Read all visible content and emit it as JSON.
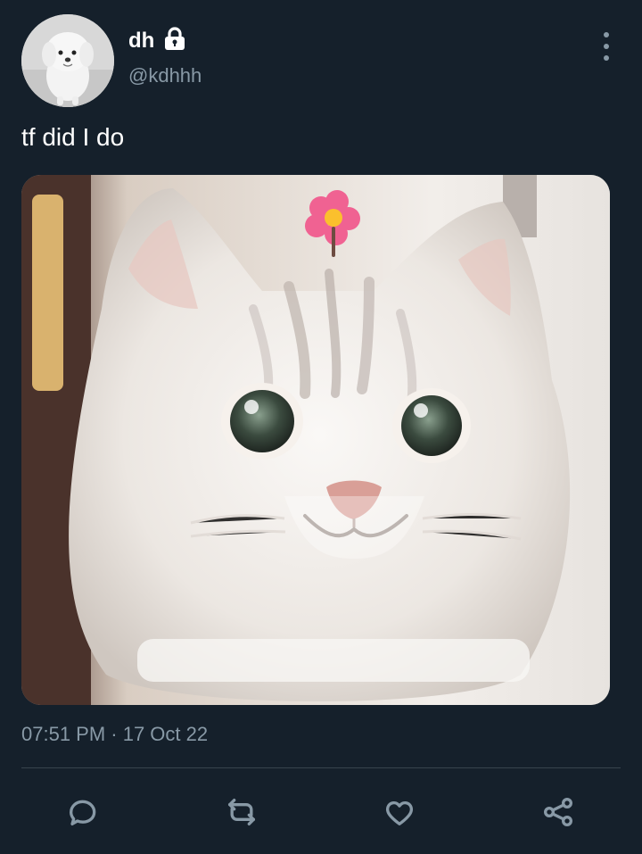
{
  "user": {
    "display_name": "dh",
    "handle": "@kdhhh",
    "protected": true
  },
  "tweet": {
    "text": "tf did I do",
    "timestamp": "07:51 PM · 17 Oct 22"
  },
  "icons": {
    "lock": "lock-icon",
    "more": "more-vertical-icon",
    "reply": "reply-icon",
    "retweet": "retweet-icon",
    "like": "heart-icon",
    "share": "share-icon"
  },
  "colors": {
    "background": "#15202b",
    "text_primary": "#ffffff",
    "text_secondary": "#8899a6",
    "divider": "#38444d",
    "flower": "#f06292"
  }
}
